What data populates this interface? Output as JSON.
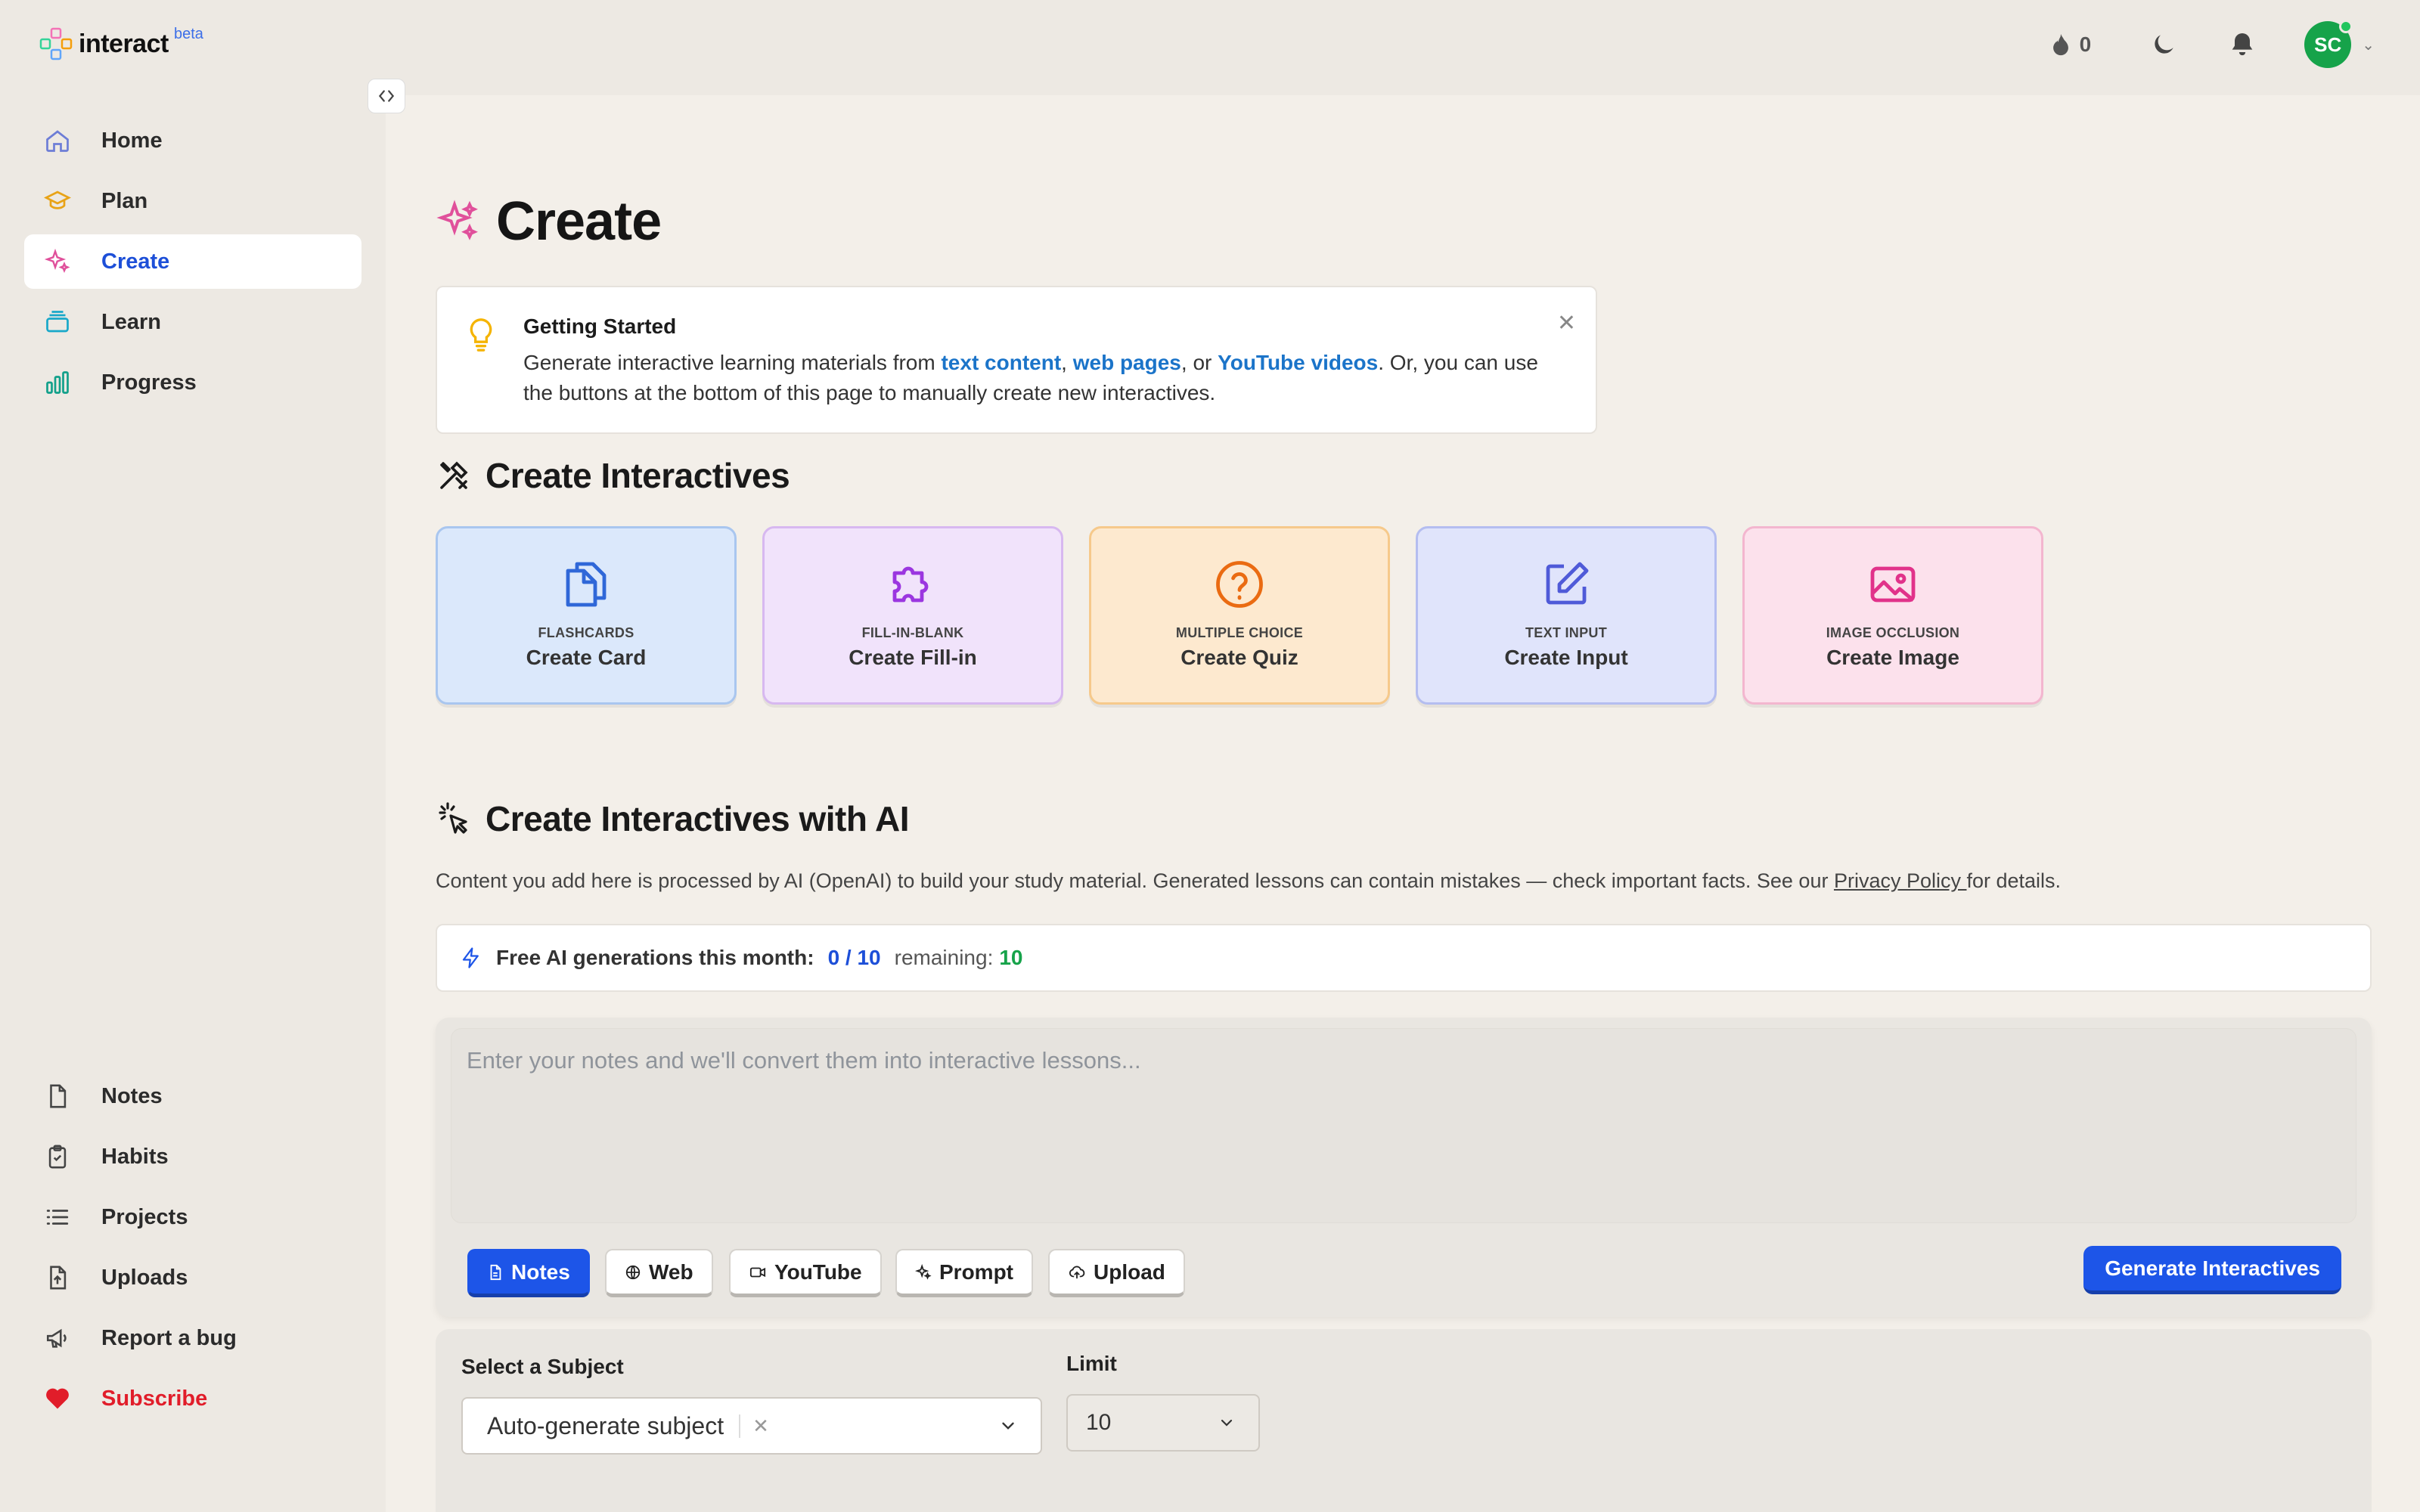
{
  "app": {
    "name": "interact",
    "badge": "beta"
  },
  "topbar": {
    "streak_count": "0",
    "avatar_initials": "SC"
  },
  "sidebar": {
    "primary": [
      {
        "label": "Home",
        "icon": "home-icon"
      },
      {
        "label": "Plan",
        "icon": "graduation-cap-icon"
      },
      {
        "label": "Create",
        "icon": "sparkles-icon",
        "active": true
      },
      {
        "label": "Learn",
        "icon": "stack-icon"
      },
      {
        "label": "Progress",
        "icon": "bar-chart-icon"
      }
    ],
    "secondary": [
      {
        "label": "Notes",
        "icon": "file-icon"
      },
      {
        "label": "Habits",
        "icon": "clipboard-check-icon"
      },
      {
        "label": "Projects",
        "icon": "list-icon"
      },
      {
        "label": "Uploads",
        "icon": "file-upload-icon"
      },
      {
        "label": "Report a bug",
        "icon": "megaphone-icon"
      },
      {
        "label": "Subscribe",
        "icon": "heart-icon"
      }
    ]
  },
  "page": {
    "title": "Create"
  },
  "info": {
    "title": "Getting Started",
    "text_1": "Generate interactive learning materials from ",
    "link_text": "text content",
    "sep_1": ", ",
    "link_web": "web pages",
    "sep_2": ", or ",
    "link_youtube": "YouTube videos",
    "text_2": ". Or, you can use the buttons at the bottom of this page to manually create new interactives."
  },
  "section_create": {
    "title": "Create Interactives"
  },
  "cards": [
    {
      "type": "FLASHCARDS",
      "label": "Create Card",
      "bg": "#dbe8fb",
      "border": "#a9c6ef",
      "icon_color": "#2f67d8"
    },
    {
      "type": "FILL-IN-BLANK",
      "label": "Create Fill-in",
      "bg": "#f1e3fb",
      "border": "#d7b8f0",
      "icon_color": "#9b36e0"
    },
    {
      "type": "MULTIPLE CHOICE",
      "label": "Create Quiz",
      "bg": "#fde9cf",
      "border": "#f6c98b",
      "icon_color": "#ea6b12"
    },
    {
      "type": "TEXT INPUT",
      "label": "Create Input",
      "bg": "#e0e4fb",
      "border": "#b4bdf0",
      "icon_color": "#4f5ad8"
    },
    {
      "type": "IMAGE OCCLUSION",
      "label": "Create Image",
      "bg": "#fce1ec",
      "border": "#f3b6cf",
      "icon_color": "#e1328a"
    }
  ],
  "section_ai": {
    "title": "Create Interactives with AI",
    "desc": "Content you add here is processed by AI (OpenAI) to build your study material. Generated lessons can contain mistakes — check important facts. See our ",
    "desc_link": "Privacy Policy ",
    "desc_end": "for details."
  },
  "quota": {
    "label": "Free AI generations this month:",
    "value": "0 / 10",
    "remaining_label": "remaining:",
    "remaining_value": "10"
  },
  "notes_input": {
    "placeholder": "Enter your notes and we'll convert them into interactive lessons..."
  },
  "source_tabs": [
    {
      "label": "Notes",
      "icon": "file-icon",
      "active": true
    },
    {
      "label": "Web",
      "icon": "globe-icon"
    },
    {
      "label": "YouTube",
      "icon": "video-icon"
    },
    {
      "label": "Prompt",
      "icon": "sparkles-icon"
    },
    {
      "label": "Upload",
      "icon": "cloud-upload-icon"
    }
  ],
  "generate_button": "Generate Interactives",
  "subject": {
    "label": "Select a Subject",
    "value": "Auto-generate subject"
  },
  "limit": {
    "label": "Limit",
    "value": "10"
  },
  "colors": {
    "accent": "#1d55e8",
    "active_nav": "#1d4fd8",
    "subscribe": "#e11d2a",
    "remaining": "#16a34a"
  }
}
